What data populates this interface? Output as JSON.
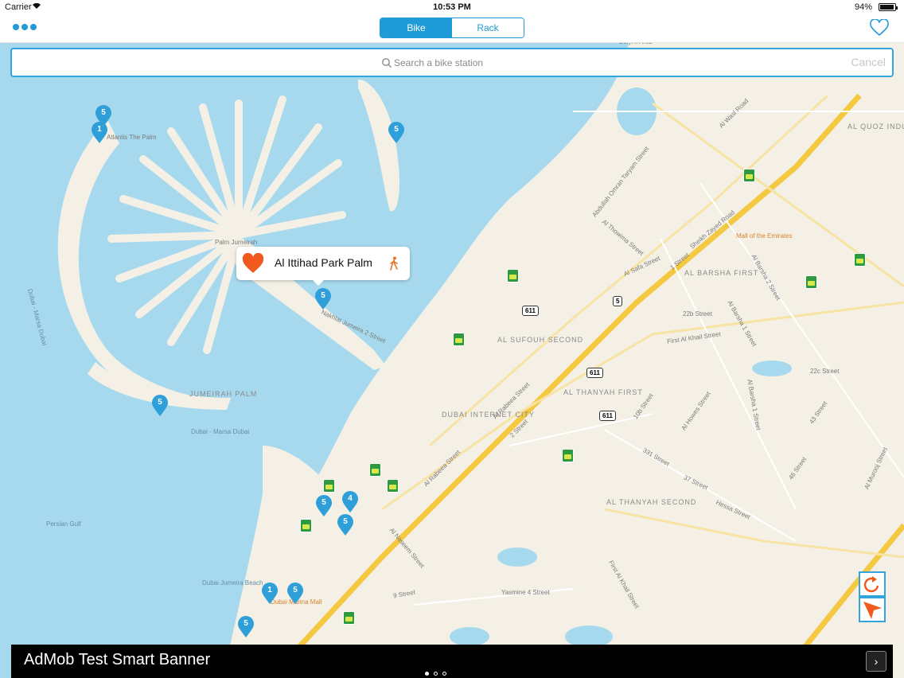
{
  "status": {
    "carrier": "Carrier",
    "time": "10:53 PM",
    "battery": "94%"
  },
  "nav": {
    "segments": [
      "Bike",
      "Rack"
    ],
    "active_segment": "Bike",
    "favorite_icon": "heart-outline-icon",
    "menu_icon": "more-dots-icon"
  },
  "search": {
    "placeholder": "Search a bike station",
    "cancel": "Cancel"
  },
  "callout": {
    "title": "Al Ittihad Park Palm",
    "heart_icon": "heart-filled-icon",
    "walk_icon": "walking-icon"
  },
  "pins": {
    "p1": "5",
    "p2": "1",
    "p3": "5",
    "p4": "5",
    "p5": "5",
    "p6": "5",
    "p7": "4",
    "p8": "5",
    "p9": "1",
    "p10": "5",
    "p11": "5"
  },
  "map_labels": {
    "atlantis": "Atlantis The Palm",
    "palm_jumeirah": "Palm Jumeirah",
    "jumeirah_palm": "JUMEIRAH PALM",
    "persian_gulf": "Persian Gulf",
    "dubai_marsa_dubai": "Dubai - Marsa Dubai",
    "dubai_marsa_dubai2": "Dubai - Marsa Dubai",
    "al_sufouh_second": "AL SUFOUH SECOND",
    "dubai_internet_city": "DUBAI INTERNET CITY",
    "al_thanyah_first": "AL THANYAH FIRST",
    "al_thanyah_second": "AL THANYAH SECOND",
    "al_barsha_first": "AL BARSHA FIRST",
    "al_quoz": "AL QUOZ INDUSTRIAL THIRD",
    "mall_of_emirates": "Mall of the Emirates",
    "dubai_marina_mall": "Dubai Marina Mall",
    "jumeirah_beach": "Dubai Jumeira Beach",
    "sheikh_zayed": "Sheikh Zayed Road",
    "al_rabeea": "Al Rabeea Street",
    "al_naseem": "Al Naseem Street",
    "al_thowima": "Al Thowima Street",
    "first_al_khail": "First Al Khail Street",
    "hessa": "Hessa Street",
    "al_wasl": "Al Wasl Road",
    "nakhlat": "Nakhlat Jumeira 2 Street",
    "burj": "Burj Al Arab",
    "al_barsha1": "Al Barsha 1 Street",
    "al_barsha2": "Al Barsha 2 Street",
    "abdullah": "Abdullah Omran Taryam Street",
    "22b": "22b Street",
    "22c": "22c Street",
    "street9": "9 Street",
    "yasmine": "Yasmine 4 Street",
    "first_al_khail2": "First Al Khail Street",
    "al_hawes": "Al Howes Street",
    "street_10b": "10b Street",
    "street_37": "37 Street",
    "street_331": "331 Street",
    "street_43": "43 Street",
    "street_46": "46 Street",
    "street_2": "2 Street",
    "street_1": "1 Street",
    "al_murooj": "Al Murooj Street",
    "al_safa": "Al Safa Street"
  },
  "shields": {
    "s1": "611",
    "s2": "611",
    "s3": "611",
    "s4": "5"
  },
  "map_buttons": {
    "refresh_icon": "refresh-icon",
    "locate_icon": "location-arrow-icon"
  },
  "ad": {
    "text": "AdMob Test Smart Banner",
    "arrow": "›"
  },
  "colors": {
    "accent": "#1f9bd7",
    "pin": "#2f9fd9",
    "water": "#a7d9ee",
    "land": "#f4f0e6",
    "highway": "#f5c842",
    "callout_heart": "#f15a1f"
  }
}
